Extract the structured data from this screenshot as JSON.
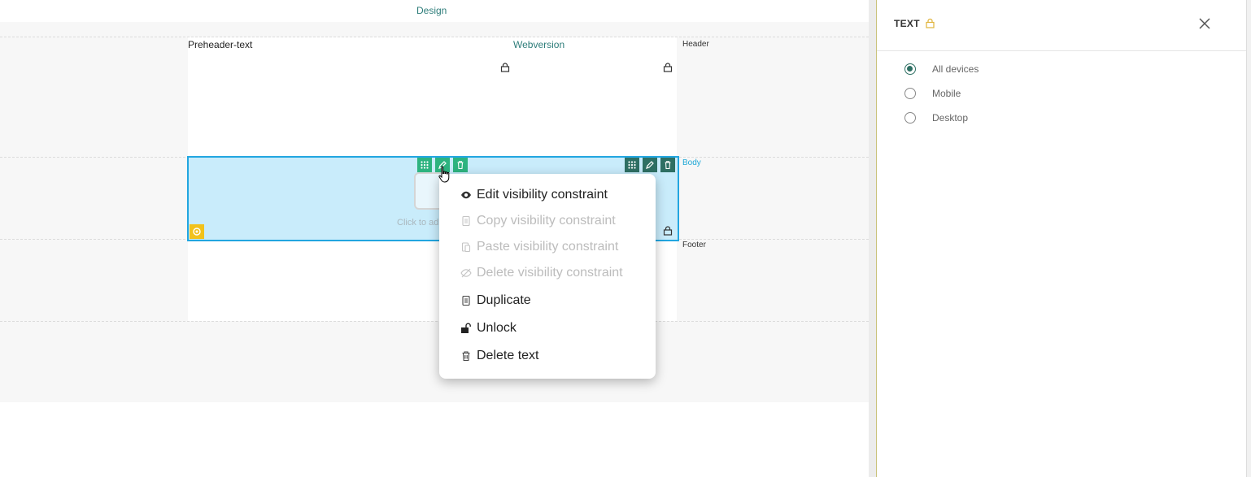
{
  "canvas": {
    "design_tab_label": "Design",
    "preheader_text": "Preheader-text",
    "webversion_label": "Webversion",
    "sections": {
      "header": "Header",
      "body": "Body",
      "footer": "Footer"
    },
    "block_placeholder": "Click to ad"
  },
  "context_menu": {
    "items": [
      {
        "label": "Edit visibility constraint",
        "icon": "eye-icon",
        "enabled": true
      },
      {
        "label": "Copy visibility constraint",
        "icon": "copy-icon",
        "enabled": false
      },
      {
        "label": "Paste visibility constraint",
        "icon": "paste-icon",
        "enabled": false
      },
      {
        "label": "Delete visibility constraint",
        "icon": "eye-slash-icon",
        "enabled": false
      },
      {
        "label": "Duplicate",
        "icon": "copy-icon",
        "enabled": true
      },
      {
        "label": "Unlock",
        "icon": "unlock-icon",
        "enabled": true
      },
      {
        "label": "Delete text",
        "icon": "trash-icon",
        "enabled": true
      }
    ]
  },
  "panel": {
    "title": "TEXT",
    "options": [
      {
        "label": "All devices",
        "selected": true
      },
      {
        "label": "Mobile",
        "selected": false
      },
      {
        "label": "Desktop",
        "selected": false
      }
    ]
  },
  "colors": {
    "accent_teal": "#2e6f63",
    "button_green": "#2db37f",
    "selection_blue": "#22a6e0",
    "lock_yellow": "#f2c21b"
  }
}
